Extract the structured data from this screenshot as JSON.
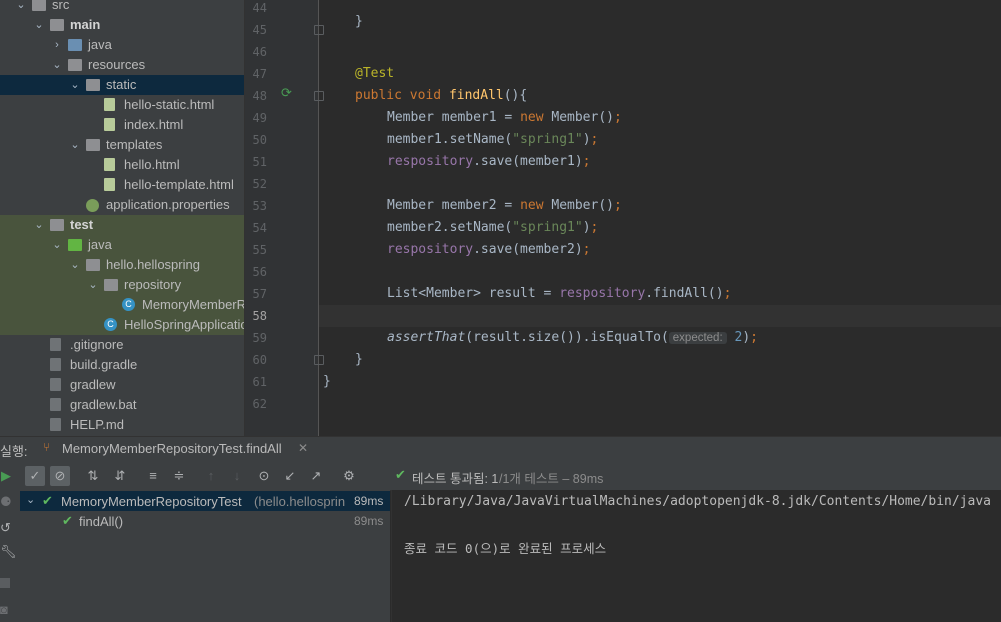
{
  "project_tree": [
    {
      "label": "src",
      "depth": 0,
      "arrow": "⌄",
      "kind": "folder"
    },
    {
      "label": "main",
      "depth": 1,
      "arrow": "⌄",
      "kind": "folder",
      "bold": true
    },
    {
      "label": "java",
      "depth": 2,
      "arrow": "›",
      "kind": "src"
    },
    {
      "label": "resources",
      "depth": 2,
      "arrow": "⌄",
      "kind": "folder"
    },
    {
      "label": "static",
      "depth": 3,
      "arrow": "⌄",
      "kind": "folder",
      "selected": true
    },
    {
      "label": "hello-static.html",
      "depth": 4,
      "kind": "html"
    },
    {
      "label": "index.html",
      "depth": 4,
      "kind": "html"
    },
    {
      "label": "templates",
      "depth": 3,
      "arrow": "⌄",
      "kind": "folder"
    },
    {
      "label": "hello.html",
      "depth": 4,
      "kind": "html"
    },
    {
      "label": "hello-template.html",
      "depth": 4,
      "kind": "html"
    },
    {
      "label": "application.properties",
      "depth": 3,
      "kind": "prop"
    },
    {
      "label": "test",
      "depth": 1,
      "arrow": "⌄",
      "kind": "folder",
      "bold": true,
      "test": true
    },
    {
      "label": "java",
      "depth": 2,
      "arrow": "⌄",
      "kind": "test",
      "test": true
    },
    {
      "label": "hello.hellospring",
      "depth": 3,
      "arrow": "⌄",
      "kind": "pkg",
      "test": true
    },
    {
      "label": "repository",
      "depth": 4,
      "arrow": "⌄",
      "kind": "pkg",
      "test": true
    },
    {
      "label": "MemoryMemberRepositoryTest",
      "depth": 5,
      "kind": "class",
      "test": true
    },
    {
      "label": "HelloSpringApplicationTests",
      "depth": 4,
      "kind": "class",
      "test": true
    },
    {
      "label": ".gitignore",
      "depth": 1,
      "kind": "file"
    },
    {
      "label": "build.gradle",
      "depth": 1,
      "kind": "gradle"
    },
    {
      "label": "gradlew",
      "depth": 1,
      "kind": "file"
    },
    {
      "label": "gradlew.bat",
      "depth": 1,
      "kind": "file"
    },
    {
      "label": "HELP.md",
      "depth": 1,
      "kind": "md"
    }
  ],
  "editor": {
    "line_numbers": [
      "44",
      "45",
      "46",
      "47",
      "48",
      "49",
      "50",
      "51",
      "52",
      "53",
      "54",
      "55",
      "56",
      "57",
      "58",
      "59",
      "60",
      "61",
      "62"
    ],
    "current_line": "58",
    "code": {
      "l45_brace": "}",
      "l47_annotation": "@Test",
      "l48_public": "public",
      "l48_void": "void",
      "l48_name": "findAll",
      "l48_rest": "(){",
      "l49_a": "Member member1 = ",
      "l49_new": "new",
      "l49_b": " Member()",
      "semi": ";",
      "l50_a": "member1.setName(",
      "l50_str": "\"spring1\"",
      "l50_b": ")",
      "l51_field": "respository",
      "l51_b": ".save(member1)",
      "l53_a": "Member member2 = ",
      "l53_new": "new",
      "l53_b": " Member()",
      "l54_a": "member2.setName(",
      "l54_str": "\"spring1\"",
      "l54_b": ")",
      "l55_field": "respository",
      "l55_b": ".save(member2)",
      "l57_a": "List<Member> result = ",
      "l57_field": "respository",
      "l57_b": ".findAll()",
      "l59_assert": "assertThat",
      "l59_a": "(result.size()).isEqualTo(",
      "l59_hint": "expected:",
      "l59_num": "2",
      "l59_b": ")",
      "l60_brace": "}",
      "l61_brace": "}"
    }
  },
  "run_panel": {
    "label": "실행:",
    "tab_title": "MemoryMemberRepositoryTest.findAll",
    "status_passed": "테스트 통과됨: 1",
    "status_total": "/1개 테스트 – 89ms",
    "tree": [
      {
        "name": "MemoryMemberRepositoryTest",
        "pkg": "(hello.hellosprin",
        "time": "89ms"
      },
      {
        "name": "findAll()",
        "pkg": "",
        "time": "89ms"
      }
    ],
    "console": [
      "/Library/Java/JavaVirtualMachines/adoptopenjdk-8.jdk/Contents/Home/bin/java ...",
      "",
      "종료 코드 0(으)로 완료된 프로세스"
    ]
  },
  "colors": {
    "selected_row": "#0d293e",
    "test_row": "#49543d",
    "passed": "#5fb85f"
  }
}
